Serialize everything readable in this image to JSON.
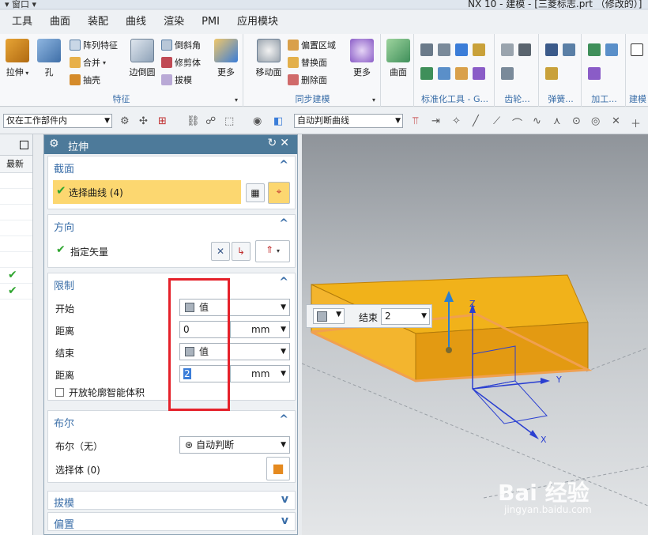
{
  "window": {
    "quick_access": "▾ 窗口 ▾",
    "title": "NX 10 - 建模 - [三菱标志.prt （修改的）]"
  },
  "menubar": [
    "工具",
    "曲面",
    "装配",
    "曲线",
    "渲染",
    "PMI",
    "应用模块"
  ],
  "ribbon": {
    "feature": {
      "extrude": "拉伸",
      "hole": "孔",
      "pattern": "阵列特征",
      "unite": "合并",
      "shell": "抽壳",
      "edge_blend": "边倒圆",
      "chamfer": "倒斜角",
      "trim_body": "修剪体",
      "draft": "拔模",
      "more": "更多",
      "label": "特征"
    },
    "sync": {
      "move_face": "移动面",
      "offset_region": "偏置区域",
      "replace_face": "替换面",
      "delete_face": "删除面",
      "more": "更多",
      "label": "同步建模"
    },
    "surface": {
      "label": "曲面"
    },
    "right_labels": [
      "标准化工具 - G...",
      "齿轮...",
      "弹簧...",
      "加工...",
      "建模"
    ]
  },
  "toolbar": {
    "scope": "仅在工作部件内",
    "curve_rule": "自动判断曲线"
  },
  "leftbar": {
    "header": "最新"
  },
  "dialog": {
    "title": "拉伸",
    "section_label": "截面",
    "select_curve": "选择曲线 (4)",
    "direction_label": "方向",
    "specify_vector": "指定矢量",
    "limits_label": "限制",
    "start_label": "开始",
    "start_value": "值",
    "distance1_label": "距离",
    "distance1_value": "0",
    "unit1": "mm",
    "end_label": "结束",
    "end_value": "值",
    "distance2_label": "距离",
    "distance2_value": "2",
    "unit2": "mm",
    "open_profile": "开放轮廓智能体积",
    "boolean_label": "布尔",
    "boolean_field": "布尔（无）",
    "boolean_value": "自动判断",
    "select_body": "选择体 (0)",
    "draft_label": "拔模",
    "offset_label": "偏置"
  },
  "viewport": {
    "float_end_label": "结束",
    "float_end_value": "2",
    "axis_z": "Z",
    "axis_y": "Y",
    "axis_x": "X"
  },
  "watermark": {
    "brand": "Bai 经验",
    "url": "jingyan.baidu.com"
  }
}
